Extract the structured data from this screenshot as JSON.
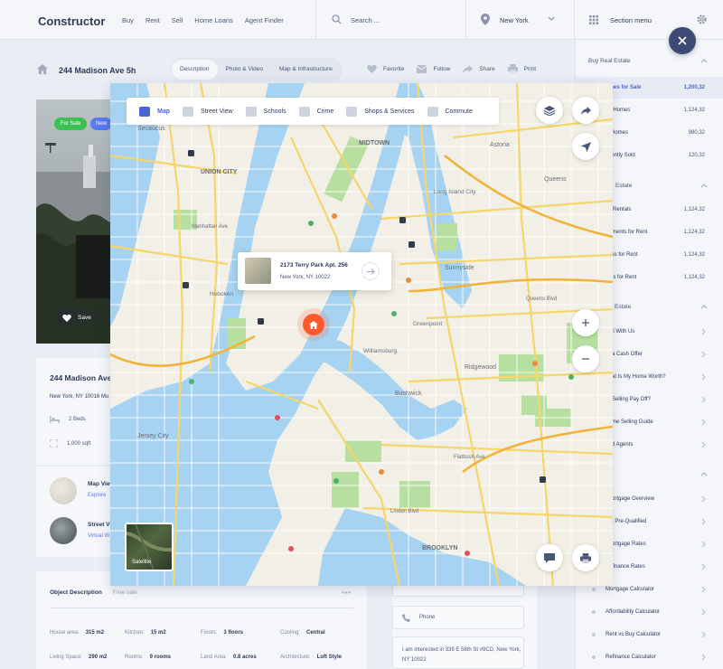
{
  "header": {
    "logo": "Constructor",
    "nav": [
      "Buy",
      "Rent",
      "Sell",
      "Home Loans",
      "Agent Finder"
    ],
    "search_placeholder": "Search ...",
    "city": "New York",
    "section_menu": "Section menu"
  },
  "subheader": {
    "address": "244 Madison Ave 5h",
    "tabs": [
      "Description",
      "Photo & Video",
      "Map & Infrastructure"
    ],
    "actions": [
      "Favorite",
      "Follow",
      "Share",
      "Print"
    ]
  },
  "listing": {
    "badge_sale": "For Sale",
    "badge_new": "New",
    "save_label": "Save",
    "address": "244 Madison Ave 5",
    "city": "New York, NY 10016 Mu",
    "beds": "2 Beds",
    "area": "1,000 sqft",
    "map_view_title": "Map View",
    "map_view_link": "Explore",
    "street_view_title": "Street Vi",
    "street_view_link": "Virtual W"
  },
  "description": {
    "tab_active": "Object Description",
    "tab_inactive": "Free sale",
    "fields": [
      {
        "k": "House area:",
        "v": "315 m2"
      },
      {
        "k": "Kitchen:",
        "v": "15 m2"
      },
      {
        "k": "Floors:",
        "v": "3 floors"
      },
      {
        "k": "Cooling:",
        "v": "Central"
      },
      {
        "k": "Living Space:",
        "v": "290 m2"
      },
      {
        "k": "Rooms:",
        "v": "9 rooms"
      },
      {
        "k": "Land Area:",
        "v": "0.8 acres"
      },
      {
        "k": "Architecture:",
        "v": "Loft Style"
      }
    ]
  },
  "contact": {
    "phone_label": "Phone",
    "message": "I am interested in 339 E 58th St #9CD, New York, NY 10022"
  },
  "map": {
    "tabs": [
      "Map",
      "Street View",
      "Schools",
      "Crime",
      "Shops & Services",
      "Commute"
    ],
    "popup_address": "2173 Terry Park Apt. 256",
    "popup_city": "New York, NY 10022",
    "satellite_label": "Satellite",
    "labels": [
      "Secaucus",
      "UNION CITY",
      "Weehawken",
      "Hoboken",
      "Sunnyside",
      "Ridgewood",
      "Bushwick",
      "BROOKLYN",
      "Linden Blvd",
      "MIDTOWN",
      "Long Island City",
      "Greenpoint",
      "Williamsburg",
      "Jersey City",
      "Astoria",
      "Queens",
      "Manhattan Ave",
      "Queens Blvd",
      "Flatbush Ave"
    ],
    "road_color": "#f6d56a",
    "water_color": "#a6d3f2",
    "land_color": "#f2efe6",
    "park_color": "#b7e0a0"
  },
  "sidebar": {
    "buy_title": "Buy Real Estate",
    "rent_title": "Estate",
    "sell_title": "Estate",
    "buy_items": [
      {
        "label": "omes for Sale",
        "count": "1,200,32",
        "active": true
      },
      {
        "label": "en Homes",
        "count": "1,124,32"
      },
      {
        "label": "w Homes",
        "count": "980,32"
      },
      {
        "label": "ecently Sold",
        "count": "120,32"
      }
    ],
    "rent_items": [
      {
        "label": "Rentals",
        "count": "1,124,32"
      },
      {
        "label": "artments for Rent",
        "count": "1,124,32"
      },
      {
        "label": "uses for Rent",
        "count": "1,124,32"
      },
      {
        "label": "oms for Rent",
        "count": "1,124,32"
      }
    ],
    "sell_items": [
      "ll With Us",
      "a Cash Offer",
      "at Is My Home Worth?",
      "Selling Pay Off?",
      "me Selling Guide",
      "d Agents"
    ],
    "loan_items": [
      "ortgage Overview",
      "t Pre-Qualified",
      "ortgage Rates",
      "finance Rates",
      "Mortgage Calculator",
      "Affordability Calculator",
      "Rent vs Buy Calculator",
      "Refinance Calculator"
    ]
  }
}
